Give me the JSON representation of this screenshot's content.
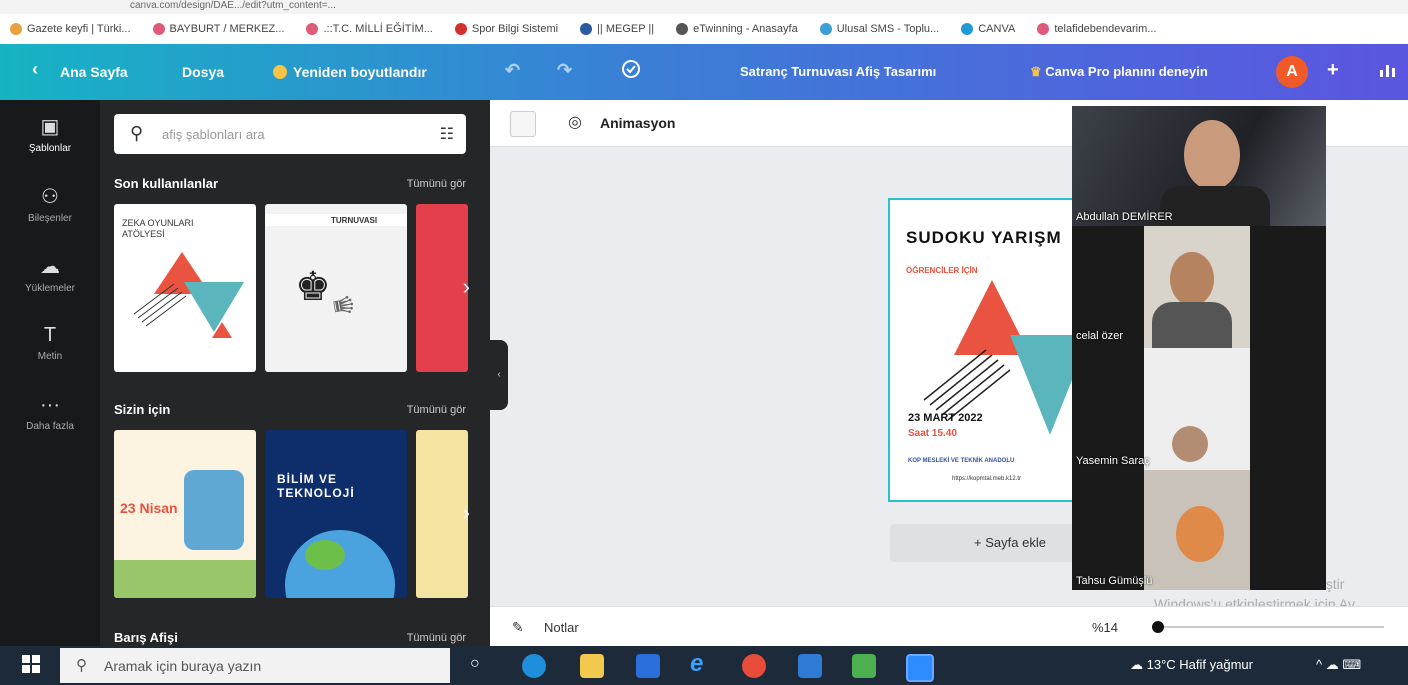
{
  "browser": {
    "url": "canva.com/design/DAE.../edit?utm_content=...",
    "bookmarks": [
      {
        "label": "Gazete keyfi | Türki...",
        "color": "#e9a23b"
      },
      {
        "label": "BAYBURT / MERKEZ...",
        "color": "#e05a7a"
      },
      {
        "label": ".::T.C. MİLLİ EĞİTİM...",
        "color": "#e05a7a"
      },
      {
        "label": "Spor Bilgi Sistemi",
        "color": "#d62f2f"
      },
      {
        "label": "|| MEGEP ||",
        "color": "#2c5aa0"
      },
      {
        "label": "eTwinning - Anasayfa",
        "color": "#555555"
      },
      {
        "label": "Ulusal SMS - Toplu...",
        "color": "#3aa0d8"
      },
      {
        "label": "CANVA",
        "color": "#1f9bd8"
      },
      {
        "label": "telafidebendevarim...",
        "color": "#e05a7a"
      }
    ]
  },
  "header": {
    "back": "‹",
    "home": "Ana Sayfa",
    "file": "Dosya",
    "resize": "Yeniden boyutlandır",
    "undo": "↶",
    "redo": "↷",
    "title": "Satranç Turnuvası Afiş Tasarımı",
    "pro": "Canva Pro planını deneyin",
    "avatar": "A",
    "plus": "+"
  },
  "sidebar": {
    "items": [
      {
        "icon": "▣",
        "label": "Şablonlar"
      },
      {
        "icon": "⚇",
        "label": "Bileşenler"
      },
      {
        "icon": "☁",
        "label": "Yüklemeler"
      },
      {
        "icon": "T",
        "label": "Metin"
      },
      {
        "icon": "···",
        "label": "Daha fazla"
      }
    ]
  },
  "panel": {
    "search_placeholder": "afiş şablonları ara",
    "sections": [
      {
        "title": "Son kullanılanlar",
        "see_all": "Tümünü gör"
      },
      {
        "title": "Sizin için",
        "see_all": "Tümünü gör"
      },
      {
        "title": "Barış Afişi",
        "see_all": "Tümünü gör"
      }
    ],
    "thumbs": {
      "t1_title": "ZEKA OYUNLARI ATÖLYESİ",
      "t2_title": "TURNUVASI",
      "t4_title": "23 Nisan",
      "t5_title": "BİLİM VE TEKNOLOJİ"
    }
  },
  "editor": {
    "animation": "Animasyon",
    "poster": {
      "title": "SUDOKU YARIŞM",
      "subtitle": "ÖĞRENCİLER İÇİN",
      "date": "23 MART 2022",
      "time": "Saat 15.40",
      "school": "KOP MESLEKİ VE TEKNİK ANADOLU",
      "url": "https://kopmtal.meb.k12.tr"
    },
    "add_page": "+ Sayfa ekle",
    "notes": "Notlar",
    "zoom": "%14"
  },
  "participants": [
    {
      "name": "Abdullah DEMİRER"
    },
    {
      "name": "celal özer"
    },
    {
      "name": "Yasemin Saraç"
    },
    {
      "name": "Tahsu Gümüşlü"
    }
  ],
  "watermark": {
    "line1": "eştir",
    "line2": "Windows'u etkinleştirmek için Ay"
  },
  "taskbar": {
    "search_placeholder": "Aramak için buraya yazın",
    "weather": "13°C  Hafif yağmur",
    "tray": "^  ☁  ⌨"
  }
}
